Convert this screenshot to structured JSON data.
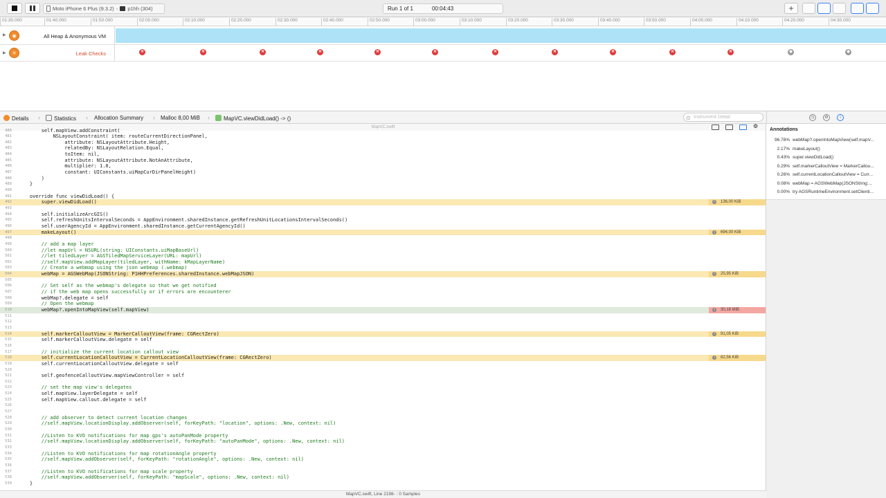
{
  "toolbar": {
    "device": "Moto iPhone 6 Plus (9.3.2)",
    "target": "p1hh (304)",
    "run": "Run 1 of 1",
    "time": "00:04:43",
    "add_label": "+"
  },
  "ruler": {
    "ticks": [
      "01:30.000",
      "01:40.000",
      "01:50.000",
      "02:00.000",
      "02:10.000",
      "02:20.000",
      "02:30.000",
      "02:40.000",
      "02:50.000",
      "03:00.000",
      "03:10.000",
      "03:20.000",
      "03:30.000",
      "03:40.000",
      "03:50.000",
      "04:00.000",
      "04:10.000",
      "04:20.000",
      "04:30.000"
    ]
  },
  "tracks": {
    "heap": {
      "name": "All Heap & Anonymous VM"
    },
    "leaks": {
      "name": "Leak Checks"
    }
  },
  "jumpbar": {
    "details": "Details",
    "statistics": "Statistics",
    "allocation_summary": "Allocation Summary",
    "malloc": "Malloc 8,00 MiB",
    "method": "MapVC.viewDidLoad() -> ()",
    "search_placeholder": "Instrument Detail"
  },
  "code": {
    "file_header": "MapVC.swift",
    "lines": [
      {
        "n": "480",
        "t": "        self.mapView.addConstraint("
      },
      {
        "n": "481",
        "t": "            NSLayoutConstraint( item: routeCurrentDirectionPanel,"
      },
      {
        "n": "482",
        "t": "                attribute: NSLayoutAttribute.Height,"
      },
      {
        "n": "483",
        "t": "                relatedBy: NSLayoutRelation.Equal,"
      },
      {
        "n": "484",
        "t": "                toItem: nil,"
      },
      {
        "n": "485",
        "t": "                attribute: NSLayoutAttribute.NotAnAttribute,"
      },
      {
        "n": "486",
        "t": "                multiplier: 1.0,"
      },
      {
        "n": "487",
        "t": "                constant: UIConstants.uiMapCurDirPanelHeight)"
      },
      {
        "n": "488",
        "t": "        )"
      },
      {
        "n": "489",
        "t": "    }"
      },
      {
        "n": "490",
        "t": ""
      },
      {
        "n": "491",
        "t": "    override func viewDidLoad() {"
      },
      {
        "n": "492",
        "t": "        super.viewDidLoad()",
        "hl": "y",
        "cost": "136,00 KiB"
      },
      {
        "n": "493",
        "t": ""
      },
      {
        "n": "494",
        "t": "        self.initializeArcGIS()"
      },
      {
        "n": "495",
        "t": "        self.refreshUnitsIntervalSeconds = AppEnvironment.sharedInstance.getRefreshUnitLocationsIntervalSeconds()"
      },
      {
        "n": "496",
        "t": "        self.userAgencyId = AppEnvironment.sharedInstance.getCurrentAgencyId()"
      },
      {
        "n": "497",
        "t": "        makeLayout()",
        "hl": "y",
        "cost": "694,00 KiB"
      },
      {
        "n": "498",
        "t": ""
      },
      {
        "n": "499",
        "t": "        // add a map layer",
        "c": true
      },
      {
        "n": "500",
        "t": "        //let mapUrl = NSURL(string: UIConstants.uiMapBaseUrl)",
        "c": true
      },
      {
        "n": "501",
        "t": "        //let tiledLayer = AGSTiledMapServiceLayer(URL: mapUrl)",
        "c": true
      },
      {
        "n": "502",
        "t": "        //self.mapView.addMapLayer(tiledLayer, withName: kMapLayerName)",
        "c": true
      },
      {
        "n": "503",
        "t": "        // Create a webmap using the json webmap (.webmap)",
        "c": true
      },
      {
        "n": "504",
        "t": "        webMap = AGSWebMap(JSONString: P1HHPreferences.sharedInstance.webMapJSON)",
        "hl": "y",
        "cost": "25,95 KiB"
      },
      {
        "n": "505",
        "t": ""
      },
      {
        "n": "506",
        "t": "        // Set self as the webmap's delegate so that we get notified",
        "c": true
      },
      {
        "n": "507",
        "t": "        // if the web map opens successfully or if errors are encounterer",
        "c": true
      },
      {
        "n": "508",
        "t": "        webMap?.delegate = self"
      },
      {
        "n": "509",
        "t": "        // Open the webmap",
        "c": true
      },
      {
        "n": "510",
        "t": "        webMap?.openIntoMapView(self.mapView)",
        "hl": "r",
        "cost": "30,18 MiB"
      },
      {
        "n": "511",
        "t": ""
      },
      {
        "n": "512",
        "t": ""
      },
      {
        "n": "513",
        "t": ""
      },
      {
        "n": "514",
        "t": "        self.markerCalloutView = MarkerCalloutView(frame: CGRectZero)",
        "hl": "y",
        "cost": "91,05 KiB"
      },
      {
        "n": "515",
        "t": "        self.markerCalloutView.delegate = self"
      },
      {
        "n": "516",
        "t": ""
      },
      {
        "n": "517",
        "t": "        // initialize the current location callout view",
        "c": true
      },
      {
        "n": "518",
        "t": "        self.currentLocationCalloutView = CurrentLocationCalloutView(frame: CGRectZero)",
        "hl": "y",
        "cost": "82,56 KiB"
      },
      {
        "n": "519",
        "t": "        self.currentLocationCalloutView.delegate = self"
      },
      {
        "n": "520",
        "t": ""
      },
      {
        "n": "521",
        "t": "        self.geofenceCalloutView.mapViewController = self"
      },
      {
        "n": "522",
        "t": ""
      },
      {
        "n": "523",
        "t": "        // set the map view's delegates",
        "c": true
      },
      {
        "n": "524",
        "t": "        self.mapView.layerDelegate = self"
      },
      {
        "n": "525",
        "t": "        self.mapView.callout.delegate = self"
      },
      {
        "n": "526",
        "t": ""
      },
      {
        "n": "527",
        "t": ""
      },
      {
        "n": "528",
        "t": "        // add observer to detect current location changes",
        "c": true
      },
      {
        "n": "529",
        "t": "        //self.mapView.locationDisplay.addObserver(self, forKeyPath: \"location\", options: .New, context: nil)",
        "c": true
      },
      {
        "n": "530",
        "t": ""
      },
      {
        "n": "531",
        "t": "        //Listen to KVO notifications for map gps's autoPanMode property",
        "c": true
      },
      {
        "n": "532",
        "t": "        //self.mapView.locationDisplay.addObserver(self, forKeyPath: \"autoPanMode\", options: .New, context: nil)",
        "c": true
      },
      {
        "n": "533",
        "t": ""
      },
      {
        "n": "534",
        "t": "        //Listen to KVO notifications for map rotationAngle property",
        "c": true
      },
      {
        "n": "535",
        "t": "        //self.mapView.addObserver(self, forKeyPath: \"rotationAngle\", options: .New, context: nil)",
        "c": true
      },
      {
        "n": "536",
        "t": ""
      },
      {
        "n": "537",
        "t": "        //Listen to KVO notifications for map scale property",
        "c": true
      },
      {
        "n": "538",
        "t": "        //self.mapView.addObserver(self, forKeyPath: \"mapScale\", options: .New, context: nil)",
        "c": true
      },
      {
        "n": "539",
        "t": "    }"
      }
    ]
  },
  "status": "MapVC.swift, Line 2198- : 0 Samples",
  "annotations": {
    "title": "Annotations",
    "rows": [
      {
        "pct": "96.78%",
        "text": "webMap?.openIntoMapView(self.mapV..."
      },
      {
        "pct": "2.17%",
        "text": "makeLayout()"
      },
      {
        "pct": "0.43%",
        "text": "super.viewDidLoad()"
      },
      {
        "pct": "0.29%",
        "text": "self.markerCalloutView = MarkerCallou..."
      },
      {
        "pct": "0.26%",
        "text": "self.currentLocationCalloutView = Curr..."
      },
      {
        "pct": "0.08%",
        "text": "webMap = AGSWebMap(JSONString:..."
      },
      {
        "pct": "0.00%",
        "text": "try AGSRuntimeEnvironment.setClienti..."
      }
    ]
  },
  "colors": {
    "hl_yellow": "#fbe8b3",
    "cost_yellow": "#f7d98c",
    "cost_red": "#f4a6a0",
    "heap_blue": "#aee3f7",
    "leak_red": "#e23b3b"
  }
}
